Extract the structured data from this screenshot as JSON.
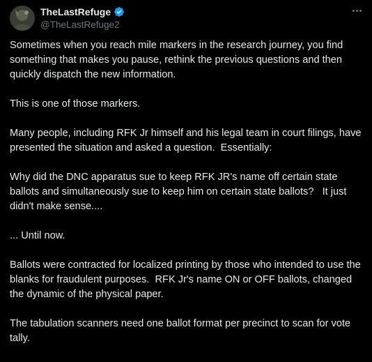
{
  "post": {
    "author": {
      "display_name": "TheLastRefuge",
      "handle": "@TheLastRefuge2",
      "verified": true,
      "verified_icon": "verified-badge-icon",
      "verified_color": "#1d9bf0"
    },
    "more_icon": "more-horizontal-icon",
    "paragraphs": [
      "Sometimes when you reach mile markers in the research journey, you find something that makes you pause, rethink the previous questions and then quickly dispatch the new information.",
      "This is one of those markers.",
      "Many people, including RFK Jr himself and his legal team in court filings, have presented the situation and asked a question.  Essentially:",
      "Why did the DNC apparatus sue to keep RFK JR's name off certain state ballots and simultaneously sue to keep him on certain state ballots?   It just didn't make sense....",
      "... Until now.",
      "Ballots were contracted for localized printing by those who intended to use the blanks for fraudulent purposes.  RFK Jr's name ON or OFF ballots, changed the dynamic of the physical paper.",
      "The tabulation scanners need one ballot format per precinct to scan for vote tally."
    ]
  },
  "colors": {
    "background": "#000000",
    "text_primary": "#e7e9ea",
    "text_secondary": "#71767b"
  }
}
